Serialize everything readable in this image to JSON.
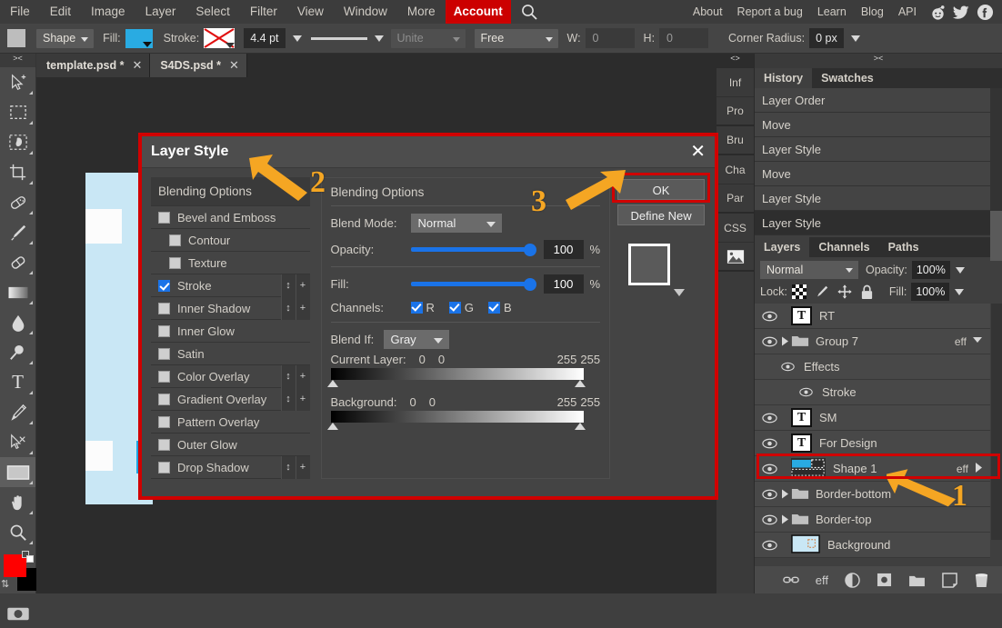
{
  "menubar": {
    "items": [
      "File",
      "Edit",
      "Image",
      "Layer",
      "Select",
      "Filter",
      "View",
      "Window",
      "More"
    ],
    "account_label": "Account",
    "search_icon": "search-icon",
    "right_links": [
      "About",
      "Report a bug",
      "Learn",
      "Blog",
      "API"
    ],
    "social": [
      "reddit-icon",
      "twitter-icon",
      "facebook-icon"
    ]
  },
  "options_bar": {
    "shape_label": "Shape",
    "fill_label": "Fill:",
    "fill_color": "#29abe2",
    "stroke_label": "Stroke:",
    "stroke_size": "4.4 pt",
    "unite_label": "Unite",
    "free_label": "Free",
    "w_label": "W:",
    "w_value": "0",
    "h_label": "H:",
    "h_value": "0",
    "corner_radius_label": "Corner Radius:",
    "corner_radius_value": "0 px"
  },
  "toolbar": {
    "collapse_glyph": "><",
    "tools": [
      {
        "name": "move-tool",
        "icon": "cursor-move-icon"
      },
      {
        "name": "rectangular-marquee-tool",
        "icon": "marquee-rect-icon"
      },
      {
        "name": "lasso-tool",
        "icon": "lasso-icon"
      },
      {
        "name": "crop-tool",
        "icon": "crop-icon"
      },
      {
        "name": "heal-tool",
        "icon": "bandage-icon"
      },
      {
        "name": "brush-tool",
        "icon": "brush-icon"
      },
      {
        "name": "eraser-tool",
        "icon": "eraser-icon"
      },
      {
        "name": "gradient-tool",
        "icon": "gradient-icon"
      },
      {
        "name": "blur-tool",
        "icon": "droplet-icon"
      },
      {
        "name": "dodge-tool",
        "icon": "dodge-icon"
      },
      {
        "name": "type-tool",
        "icon": "text-t-icon"
      },
      {
        "name": "pen-tool",
        "icon": "pen-icon"
      },
      {
        "name": "path-select-tool",
        "icon": "path-select-icon"
      },
      {
        "name": "shape-tool",
        "icon": "rectangle-icon"
      },
      {
        "name": "hand-tool",
        "icon": "hand-icon"
      },
      {
        "name": "zoom-tool",
        "icon": "magnifier-icon"
      }
    ],
    "foreground_color": "#ff0000",
    "background_color": "#000000",
    "camera_icon": "camera-icon"
  },
  "tabs": [
    {
      "title": "template.psd *",
      "active": false
    },
    {
      "title": "S4DS.psd *",
      "active": true
    }
  ],
  "vertical_tabs": {
    "collapse_glyph": "<>",
    "items": [
      "Inf",
      "Pro",
      "Bru",
      "Cha",
      "Par",
      "CSS"
    ],
    "image_icon": "image-thumbnail-icon"
  },
  "dialog": {
    "title": "Layer Style",
    "close_glyph": "✕",
    "effects": [
      {
        "label": "Blending Options",
        "checkbox": null,
        "indent": false,
        "buttons": false
      },
      {
        "label": "Bevel and Emboss",
        "checkbox": false,
        "indent": false,
        "buttons": false
      },
      {
        "label": "Contour",
        "checkbox": false,
        "indent": true,
        "buttons": false
      },
      {
        "label": "Texture",
        "checkbox": false,
        "indent": true,
        "buttons": false
      },
      {
        "label": "Stroke",
        "checkbox": true,
        "indent": false,
        "buttons": true
      },
      {
        "label": "Inner Shadow",
        "checkbox": false,
        "indent": false,
        "buttons": true
      },
      {
        "label": "Inner Glow",
        "checkbox": false,
        "indent": false,
        "buttons": false
      },
      {
        "label": "Satin",
        "checkbox": false,
        "indent": false,
        "buttons": false
      },
      {
        "label": "Color Overlay",
        "checkbox": false,
        "indent": false,
        "buttons": true
      },
      {
        "label": "Gradient Overlay",
        "checkbox": false,
        "indent": false,
        "buttons": true
      },
      {
        "label": "Pattern Overlay",
        "checkbox": false,
        "indent": false,
        "buttons": false
      },
      {
        "label": "Outer Glow",
        "checkbox": false,
        "indent": false,
        "buttons": false
      },
      {
        "label": "Drop Shadow",
        "checkbox": false,
        "indent": false,
        "buttons": true
      }
    ],
    "fx_button_up_down": "↕",
    "fx_button_plus": "+",
    "settings": {
      "section_title": "Blending Options",
      "blend_mode_label": "Blend Mode:",
      "blend_mode_value": "Normal",
      "opacity_label": "Opacity:",
      "opacity_value": "100",
      "opacity_unit": "%",
      "fill_label": "Fill:",
      "fill_value": "100",
      "fill_unit": "%",
      "channels_label": "Channels:",
      "channels": [
        "R",
        "G",
        "B"
      ],
      "blend_if_label": "Blend If:",
      "blend_if_value": "Gray",
      "current_layer_label": "Current Layer:",
      "current_layer_low": "0",
      "current_layer_low2": "0",
      "current_layer_high": "255",
      "current_layer_high2": "255",
      "background_label": "Background:",
      "background_low": "0",
      "background_low2": "0",
      "background_high": "255",
      "background_high2": "255"
    },
    "buttons": {
      "ok": "OK",
      "define_new": "Define New"
    }
  },
  "annotations": [
    {
      "number": "1",
      "target": "shape-1-layer"
    },
    {
      "number": "2",
      "target": "layer-style-dialog"
    },
    {
      "number": "3",
      "target": "ok-button"
    }
  ],
  "right_panel": {
    "collapse_glyph": "><",
    "top_tabs": [
      {
        "label": "History",
        "active": true
      },
      {
        "label": "Swatches",
        "active": false
      }
    ],
    "history": [
      {
        "label": "Layer Order",
        "current": false
      },
      {
        "label": "Move",
        "current": false
      },
      {
        "label": "Layer Style",
        "current": false
      },
      {
        "label": "Move",
        "current": false
      },
      {
        "label": "Layer Style",
        "current": false
      },
      {
        "label": "Layer Style",
        "current": true
      }
    ],
    "layer_tabs": [
      {
        "label": "Layers",
        "active": true
      },
      {
        "label": "Channels",
        "active": false
      },
      {
        "label": "Paths",
        "active": false
      }
    ],
    "blend_mode": "Normal",
    "opacity_label": "Opacity:",
    "opacity_value": "100%",
    "lock_label": "Lock:",
    "lock_icons": [
      "checker-transparency-icon",
      "brush-icon",
      "move-arrows-icon",
      "lock-icon"
    ],
    "fill_label": "Fill:",
    "fill_value": "100%",
    "layers": [
      {
        "name": "RT",
        "type": "text",
        "indent": 0,
        "eff": false,
        "highlight": false
      },
      {
        "name": "Group 7",
        "type": "group",
        "indent": 0,
        "eff": true,
        "highlight": false
      },
      {
        "name": "Effects",
        "type": "effects",
        "indent": 1,
        "eff": false,
        "highlight": false
      },
      {
        "name": "Stroke",
        "type": "effect",
        "indent": 2,
        "eff": false,
        "highlight": false
      },
      {
        "name": "SM",
        "type": "text",
        "indent": 0,
        "eff": false,
        "highlight": false
      },
      {
        "name": "For Design",
        "type": "text",
        "indent": 0,
        "eff": false,
        "highlight": false
      },
      {
        "name": "Shape 1",
        "type": "shape",
        "indent": 0,
        "eff": true,
        "highlight": true
      },
      {
        "name": "Border-bottom",
        "type": "group",
        "indent": 0,
        "eff": false,
        "highlight": false
      },
      {
        "name": "Border-top",
        "type": "group",
        "indent": 0,
        "eff": false,
        "highlight": false
      },
      {
        "name": "Background",
        "type": "image",
        "indent": 0,
        "eff": false,
        "highlight": false
      }
    ],
    "bottom_icons": [
      "link-icon",
      "eff-icon",
      "adjustment-halfcircle-icon",
      "mask-icon",
      "new-group-folder-icon",
      "new-layer-icon",
      "delete-trash-icon"
    ],
    "eff_label": "eff"
  },
  "colors": {
    "accent_red": "#d00000",
    "accent_orange": "#f5a623",
    "blue_slider": "#1a73e8",
    "panel_bg": "#3f3f3f",
    "artwork_blue": "#c9e7f5"
  }
}
